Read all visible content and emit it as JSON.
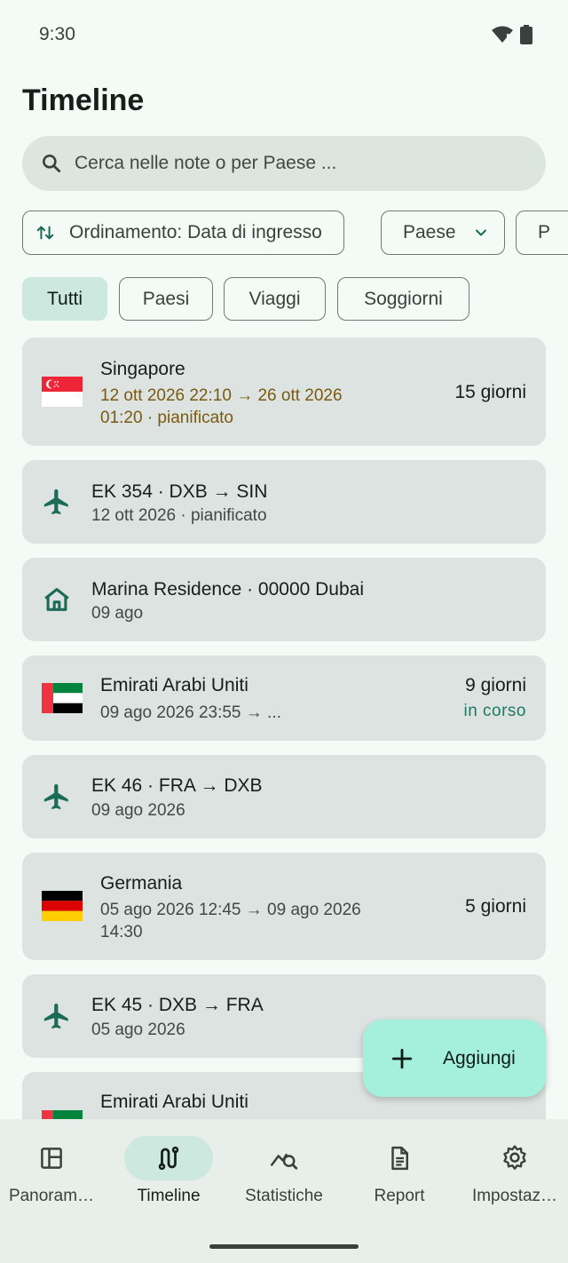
{
  "status_bar": {
    "time": "9:30"
  },
  "header": {
    "title": "Timeline"
  },
  "search": {
    "placeholder": "Cerca nelle note o per Paese ..."
  },
  "sort_chips": {
    "sort_label": "Ordinamento: Data di ingresso",
    "country_label": "Paese",
    "extra_label": "P"
  },
  "filter_chips": {
    "all": "Tutti",
    "countries": "Paesi",
    "trips": "Viaggi",
    "stays": "Soggiorni",
    "selected": "Tutti"
  },
  "timeline": [
    {
      "kind": "country",
      "flag": "singapore-flag",
      "title": "Singapore",
      "dates_line1": "12 ott 2026 22:10  →  26 ott 2026",
      "dates_line2": "01:20 · pianificato",
      "duration": "15 giorni"
    },
    {
      "kind": "flight",
      "icon": "airplane-icon",
      "title": "EK 354 · DXB → SIN",
      "subtitle": "12 ott 2026 · pianificato"
    },
    {
      "kind": "stay",
      "icon": "house-icon",
      "title": "Marina Residence · 00000 Dubai",
      "subtitle": "09 ago"
    },
    {
      "kind": "country",
      "flag": "uae-flag",
      "title": "Emirati Arabi Uniti",
      "dates_line1": "09 ago 2026 23:55  →  ...",
      "duration": "9 giorni",
      "status": "in corso"
    },
    {
      "kind": "flight",
      "icon": "airplane-icon",
      "title": "EK 46 · FRA → DXB",
      "subtitle": "09 ago 2026"
    },
    {
      "kind": "country",
      "flag": "germany-flag",
      "title": "Germania",
      "dates_line1": "05 ago 2026 12:45  →  09 ago 2026",
      "dates_line2": "14:30",
      "duration": "5 giorni"
    },
    {
      "kind": "flight",
      "icon": "airplane-icon",
      "title": "EK 45 · DXB → FRA",
      "subtitle": "05 ago 2026"
    },
    {
      "kind": "country",
      "flag": "uae-flag",
      "title": "Emirati Arabi Uniti"
    }
  ],
  "fab": {
    "label": "Aggiungi"
  },
  "bottom_nav": [
    {
      "label": "Panoram…",
      "icon": "dashboard-icon"
    },
    {
      "label": "Timeline",
      "icon": "timeline-icon",
      "active": true
    },
    {
      "label": "Statistiche",
      "icon": "statistics-icon"
    },
    {
      "label": "Report",
      "icon": "report-icon"
    },
    {
      "label": "Impostaz…",
      "icon": "settings-icon"
    }
  ],
  "colors": {
    "background": "#f4faf6",
    "card": "#dde3e0",
    "accent_container": "#cde8de",
    "fab": "#a5f0dc",
    "icon_teal": "#1b6b57",
    "planned_text": "#7a5a10",
    "ongoing_text": "#1b7a63"
  }
}
